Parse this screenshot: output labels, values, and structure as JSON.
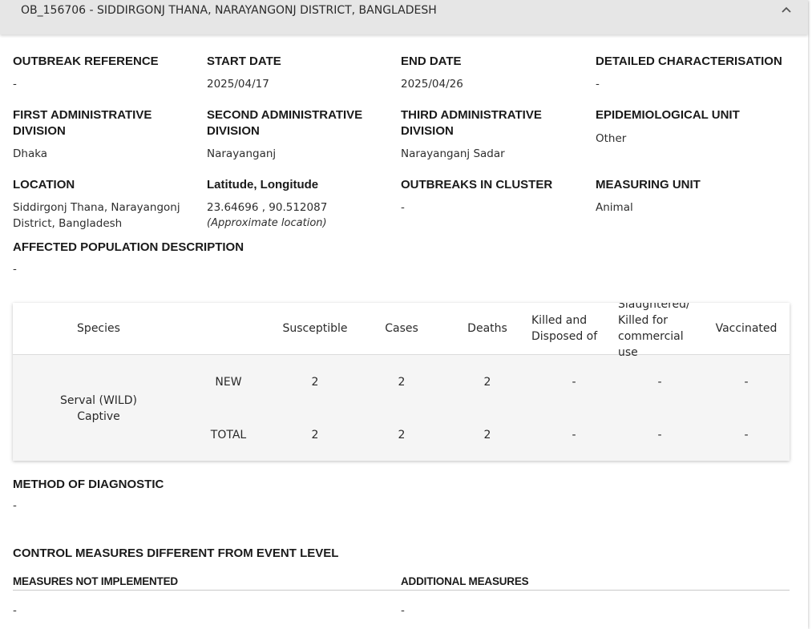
{
  "header": {
    "title": "OB_156706 - SIDDIRGONJ THANA, NARAYANGONJ DISTRICT, BANGLADESH"
  },
  "fields": {
    "outbreak_reference": {
      "label": "OUTBREAK REFERENCE",
      "value": "-"
    },
    "start_date": {
      "label": "START DATE",
      "value": "2025/04/17"
    },
    "end_date": {
      "label": "END DATE",
      "value": "2025/04/26"
    },
    "detailed_characterisation": {
      "label": "DETAILED CHARACTERISATION",
      "value": "-"
    },
    "first_admin": {
      "label_line1": "FIRST ADMINISTRATIVE",
      "label_line2": "DIVISION",
      "value": "Dhaka"
    },
    "second_admin": {
      "label_line1": "SECOND ADMINISTRATIVE",
      "label_line2": "DIVISION",
      "value": "Narayanganj"
    },
    "third_admin": {
      "label_line1": "THIRD ADMINISTRATIVE",
      "label_line2": "DIVISION",
      "value": "Narayanganj Sadar"
    },
    "epi_unit": {
      "label": "EPIDEMIOLOGICAL UNIT",
      "value": "Other"
    },
    "location": {
      "label": "LOCATION",
      "value_line1": "Siddirgonj Thana, Narayangonj",
      "value_line2": "District, Bangladesh"
    },
    "latlong": {
      "label": "Latitude, Longitude",
      "value": "23.64696 , 90.512087",
      "note": "(Approximate location)"
    },
    "outbreaks_in_cluster": {
      "label": "OUTBREAKS IN CLUSTER",
      "value": "-"
    },
    "measuring_unit": {
      "label": "MEASURING UNIT",
      "value": "Animal"
    },
    "affected_population": {
      "label": "AFFECTED POPULATION DESCRIPTION",
      "value": "-"
    }
  },
  "table": {
    "headers": {
      "species": "Species",
      "susceptible": "Susceptible",
      "cases": "Cases",
      "deaths": "Deaths",
      "killed_line1": "Killed and",
      "killed_line2": "Disposed of",
      "slaughtered_line1": "Slaughtered/",
      "slaughtered_line2": "Killed for",
      "slaughtered_line3": "commercial",
      "slaughtered_line4": "use",
      "vaccinated": "Vaccinated"
    },
    "species_line1": "Serval (WILD)",
    "species_line2": "Captive",
    "rows": [
      {
        "type": "NEW",
        "susceptible": "2",
        "cases": "2",
        "deaths": "2",
        "killed": "-",
        "slaughtered": "-",
        "vaccinated": "-"
      },
      {
        "type": "TOTAL",
        "susceptible": "2",
        "cases": "2",
        "deaths": "2",
        "killed": "-",
        "slaughtered": "-",
        "vaccinated": "-"
      }
    ]
  },
  "diagnostic": {
    "label": "METHOD OF DIAGNOSTIC",
    "value": "-"
  },
  "control": {
    "title": "CONTROL MEASURES DIFFERENT FROM EVENT LEVEL",
    "not_implemented_label": "MEASURES NOT IMPLEMENTED",
    "not_implemented_value": "-",
    "additional_label": "ADDITIONAL MEASURES",
    "additional_value": "-"
  },
  "icons": {
    "collapse": "chevron-up-icon"
  }
}
